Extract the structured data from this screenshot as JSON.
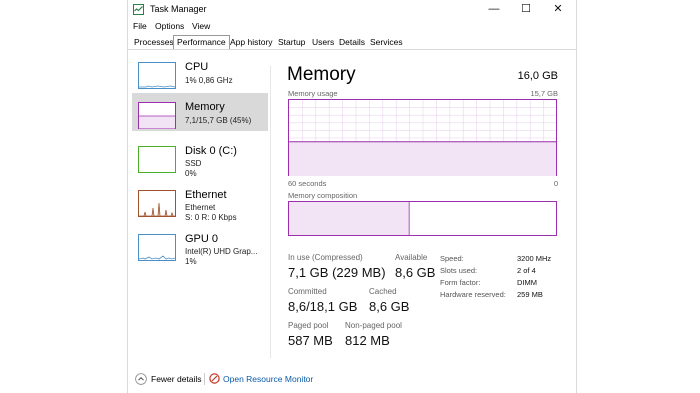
{
  "window": {
    "title": "Task Manager",
    "controls": {
      "minimize": "—",
      "maximize": "☐",
      "close": "✕"
    }
  },
  "menu": [
    "File",
    "Options",
    "View"
  ],
  "tabs": [
    "Processes",
    "Performance",
    "App history",
    "Startup",
    "Users",
    "Details",
    "Services"
  ],
  "active_tab": "Performance",
  "sidebar": [
    {
      "title": "CPU",
      "line1": "1% 0,86 GHz",
      "line2": "",
      "color": "#4a8fc7",
      "selected": false
    },
    {
      "title": "Memory",
      "line1": "7,1/15,7 GB (45%)",
      "line2": "",
      "color": "#9b2fae",
      "selected": true
    },
    {
      "title": "Disk 0 (C:)",
      "line1": "SSD",
      "line2": "0%",
      "color": "#4caf2a",
      "selected": false
    },
    {
      "title": "Ethernet",
      "line1": "Ethernet",
      "line2": "S: 0 R: 0 Kbps",
      "color": "#a0522d",
      "selected": false
    },
    {
      "title": "GPU 0",
      "line1": "Intel(R) UHD Grap...",
      "line2": "1%",
      "color": "#4a8fc7",
      "selected": false
    }
  ],
  "memory": {
    "title": "Memory",
    "total": "16,0 GB",
    "usage_label": "Memory usage",
    "usage_max": "15,7 GB",
    "time_label": "60 seconds",
    "time_min": "0",
    "usage_fraction": 0.45,
    "composition_label": "Memory composition",
    "in_use_fraction": 0.45,
    "accent_color": "#9b2fae"
  },
  "stats": {
    "in_use": {
      "label": "In use (Compressed)",
      "value": "7,1 GB (229 MB)"
    },
    "available": {
      "label": "Available",
      "value": "8,6 GB"
    },
    "committed": {
      "label": "Committed",
      "value": "8,6/18,1 GB"
    },
    "cached": {
      "label": "Cached",
      "value": "8,6 GB"
    },
    "paged_pool": {
      "label": "Paged pool",
      "value": "587 MB"
    },
    "non_paged_pool": {
      "label": "Non-paged pool",
      "value": "812 MB"
    }
  },
  "specs": [
    {
      "label": "Speed:",
      "value": "3200 MHz"
    },
    {
      "label": "Slots used:",
      "value": "2 of 4"
    },
    {
      "label": "Form factor:",
      "value": "DIMM"
    },
    {
      "label": "Hardware reserved:",
      "value": "259 MB"
    }
  ],
  "footer": {
    "fewer_details": "Fewer details",
    "open_resource_monitor": "Open Resource Monitor"
  }
}
